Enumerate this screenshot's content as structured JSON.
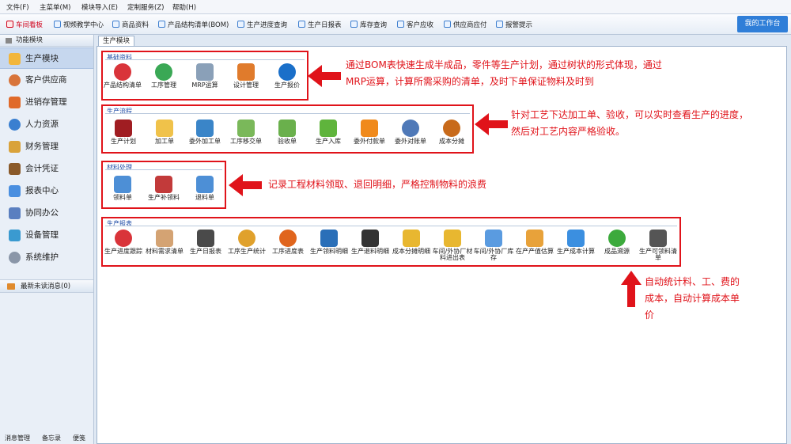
{
  "menu": [
    "文件(F)",
    "主菜单(M)",
    "模块导入(E)",
    "定制服务(Z)",
    "帮助(H)"
  ],
  "toolbar": [
    {
      "label": "车间看板",
      "icon": "board-icon",
      "highlight": true
    },
    {
      "label": "视频教学中心",
      "icon": "video-icon"
    },
    {
      "label": "商品资料",
      "icon": "goods-icon"
    },
    {
      "label": "产品结构清单(BOM)",
      "icon": "bom-icon"
    },
    {
      "label": "生产进度查询",
      "icon": "progress-icon"
    },
    {
      "label": "生产日报表",
      "icon": "report-icon"
    },
    {
      "label": "库存查询",
      "icon": "stock-icon"
    },
    {
      "label": "客户应收",
      "icon": "receivable-icon"
    },
    {
      "label": "供应商应付",
      "icon": "payable-icon"
    },
    {
      "label": "报警提示",
      "icon": "alarm-icon"
    }
  ],
  "my_work_label": "我的工作台",
  "sidebar": {
    "header": "功能模块",
    "items": [
      {
        "label": "生产模块",
        "icon": "folder-icon",
        "active": true
      },
      {
        "label": "客户供应商",
        "icon": "contacts-icon"
      },
      {
        "label": "进销存管理",
        "icon": "inventory-icon"
      },
      {
        "label": "人力资源",
        "icon": "person-icon"
      },
      {
        "label": "财务管理",
        "icon": "finance-icon"
      },
      {
        "label": "会计凭证",
        "icon": "voucher-icon"
      },
      {
        "label": "报表中心",
        "icon": "chart-icon"
      },
      {
        "label": "协同办公",
        "icon": "calendar-icon"
      },
      {
        "label": "设备管理",
        "icon": "device-icon"
      },
      {
        "label": "系统维护",
        "icon": "settings-icon"
      }
    ],
    "messages": "最新未读消息(0)",
    "bottom": [
      "消息管理",
      "备忘录",
      "便笺"
    ]
  },
  "tab_label": "生产模块",
  "groups": [
    {
      "title": "基础资料",
      "items": [
        {
          "label": "产品结构清单",
          "icon": "pie-icon",
          "color": "#d9343a"
        },
        {
          "label": "工序管理",
          "icon": "globe-icon",
          "color": "#3aa855"
        },
        {
          "label": "MRP运算",
          "icon": "pencil-icon",
          "color": "#8aa0b8"
        },
        {
          "label": "设计管理",
          "icon": "design-icon",
          "color": "#e07b2c"
        },
        {
          "label": "生产报价",
          "icon": "p-icon",
          "color": "#1a6fc9"
        }
      ]
    },
    {
      "title": "生产流程",
      "items": [
        {
          "label": "生产计划",
          "icon": "plan-icon",
          "color": "#a01d22"
        },
        {
          "label": "加工单",
          "icon": "document-icon",
          "color": "#f0c24a"
        },
        {
          "label": "委外加工单",
          "icon": "outsource-icon",
          "color": "#3a85c8"
        },
        {
          "label": "工序移交单",
          "icon": "handover-icon",
          "color": "#7ab85a"
        },
        {
          "label": "验收单",
          "icon": "check-icon",
          "color": "#6ab04c"
        },
        {
          "label": "生产入库",
          "icon": "arrow-in-icon",
          "color": "#5fb43c"
        },
        {
          "label": "委外付款单",
          "icon": "rss-icon",
          "color": "#f08a1c"
        },
        {
          "label": "委外对账单",
          "icon": "p-round-icon",
          "color": "#4f79b8"
        },
        {
          "label": "成本分摊",
          "icon": "donut-icon",
          "color": "#c86a1a"
        }
      ]
    },
    {
      "title": "材料处理",
      "items": [
        {
          "label": "领料单",
          "icon": "arrow-right-icon",
          "color": "#4d8fd6"
        },
        {
          "label": "生产补领料",
          "icon": "form-icon",
          "color": "#c23a3a"
        },
        {
          "label": "退料单",
          "icon": "arrow-left-icon",
          "color": "#4d8fd6"
        }
      ]
    },
    {
      "title": "生产报表",
      "items": [
        {
          "label": "生产进度跟踪",
          "icon": "clock-icon",
          "color": "#d9343a"
        },
        {
          "label": "材料需求清单",
          "icon": "edit-icon",
          "color": "#d4a373"
        },
        {
          "label": "生产日报表",
          "icon": "table-icon",
          "color": "#4a4a4a"
        },
        {
          "label": "工序生产统计",
          "icon": "pin-icon",
          "color": "#e0a12c"
        },
        {
          "label": "工序进度表",
          "icon": "pie2-icon",
          "color": "#e0651d"
        },
        {
          "label": "生产领料明细",
          "icon": "book-icon",
          "color": "#2a6fb8"
        },
        {
          "label": "生产退料明细",
          "icon": "safe-icon",
          "color": "#333333"
        },
        {
          "label": "成本分摊明细",
          "icon": "star-box-icon",
          "color": "#e8b730"
        },
        {
          "label": "车间/外协厂材料进出表",
          "icon": "star-box2-icon",
          "color": "#e8b730"
        },
        {
          "label": "车间/外协厂库存",
          "icon": "bars-icon",
          "color": "#5a9be0"
        },
        {
          "label": "在产产值估算",
          "icon": "calc-icon",
          "color": "#e8a23a"
        },
        {
          "label": "生产成本计算",
          "icon": "bars2-icon",
          "color": "#3b8fe0"
        },
        {
          "label": "成品溯源",
          "icon": "refresh-icon",
          "color": "#3caa3c"
        },
        {
          "label": "生产可领料清单",
          "icon": "copy-icon",
          "color": "#555555"
        }
      ]
    }
  ],
  "notes": {
    "bom": [
      "通过BOM表快速生成半成品，零件等生产计划，通过树状的形式体现，通过",
      "MRP运算，计算所需采购的清单，及时下单保证物料及时到"
    ],
    "process": [
      "针对工艺下达加工单、验收，可以实时查看生产的进度，",
      "然后对工艺内容严格验收。"
    ],
    "material": "记录工程材料领取、退回明细，严格控制物料的浪费",
    "report": [
      "自动统计料、工、费的",
      "成本，自动计算成本单",
      "价"
    ]
  }
}
